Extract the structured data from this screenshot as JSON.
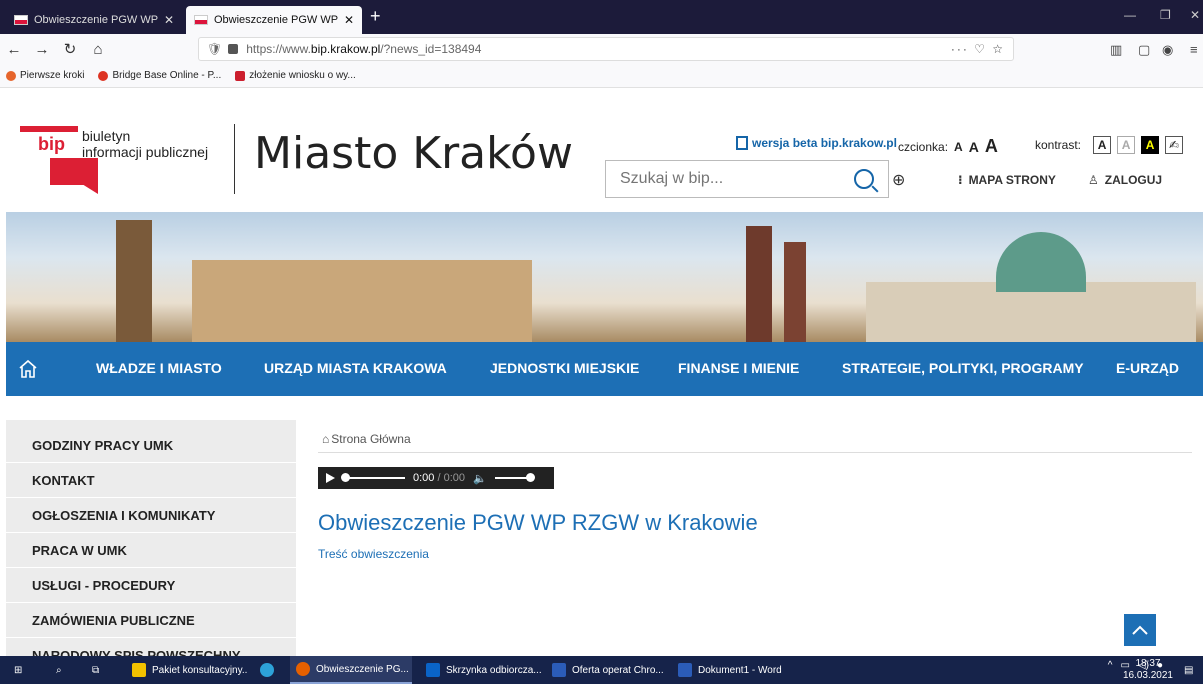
{
  "browser": {
    "tabs": [
      {
        "title": "Obwieszczenie PGW WP RZGW",
        "active": false
      },
      {
        "title": "Obwieszczenie PGW WP RZGW",
        "active": true
      }
    ],
    "url_prefix": "https://www.",
    "url_host": "bip.krakow.pl",
    "url_path": "/?news_id=138494",
    "bookmarks": [
      "Pierwsze kroki",
      "Bridge Base Online - P...",
      "złożenie wniosku o wy..."
    ]
  },
  "header": {
    "logo_mark": "bip",
    "logo_line1": "biuletyn",
    "logo_line2": "informacji publicznej",
    "city": "Miasto Kraków",
    "beta_link": "wersja beta bip.krakow.pl",
    "font_label": "czcionka:",
    "font_sizes": [
      "A",
      "A",
      "A"
    ],
    "contrast_label": "kontrast:",
    "contrast_options": [
      "A",
      "A",
      "A"
    ],
    "search_placeholder": "Szukaj w bip...",
    "sitemap": "MAPA STRONY",
    "login": "ZALOGUJ"
  },
  "nav": [
    "WŁADZE I MIASTO",
    "URZĄD MIASTA KRAKOWA",
    "JEDNOSTKI MIEJSKIE",
    "FINANSE I MIENIE",
    "STRATEGIE, POLITYKI, PROGRAMY",
    "E-URZĄD"
  ],
  "sidebar": [
    "GODZINY PRACY UMK",
    "KONTAKT",
    "OGŁOSZENIA I KOMUNIKATY",
    "PRACA W UMK",
    "USŁUGI - PROCEDURY",
    "ZAMÓWIENIA PUBLICZNE",
    "NARODOWY SPIS POWSZECHNY"
  ],
  "content": {
    "breadcrumb": "Strona Główna",
    "player_time": "0:00",
    "player_duration": "/ 0:00",
    "title": "Obwieszczenie PGW WP RZGW w Krakowie",
    "link": "Treść obwieszczenia"
  },
  "taskbar": {
    "apps": [
      "Pakiet konsultacyjny...",
      "Obwieszczenie PG...",
      "Skrzynka odbiorcza...",
      "Oferta operat Chro...",
      "Dokument1 - Word"
    ],
    "time": "18:37",
    "date": "16.03.2021"
  },
  "colors": {
    "brand_blue": "#1d6fb5",
    "bip_red": "#dc1f34"
  }
}
